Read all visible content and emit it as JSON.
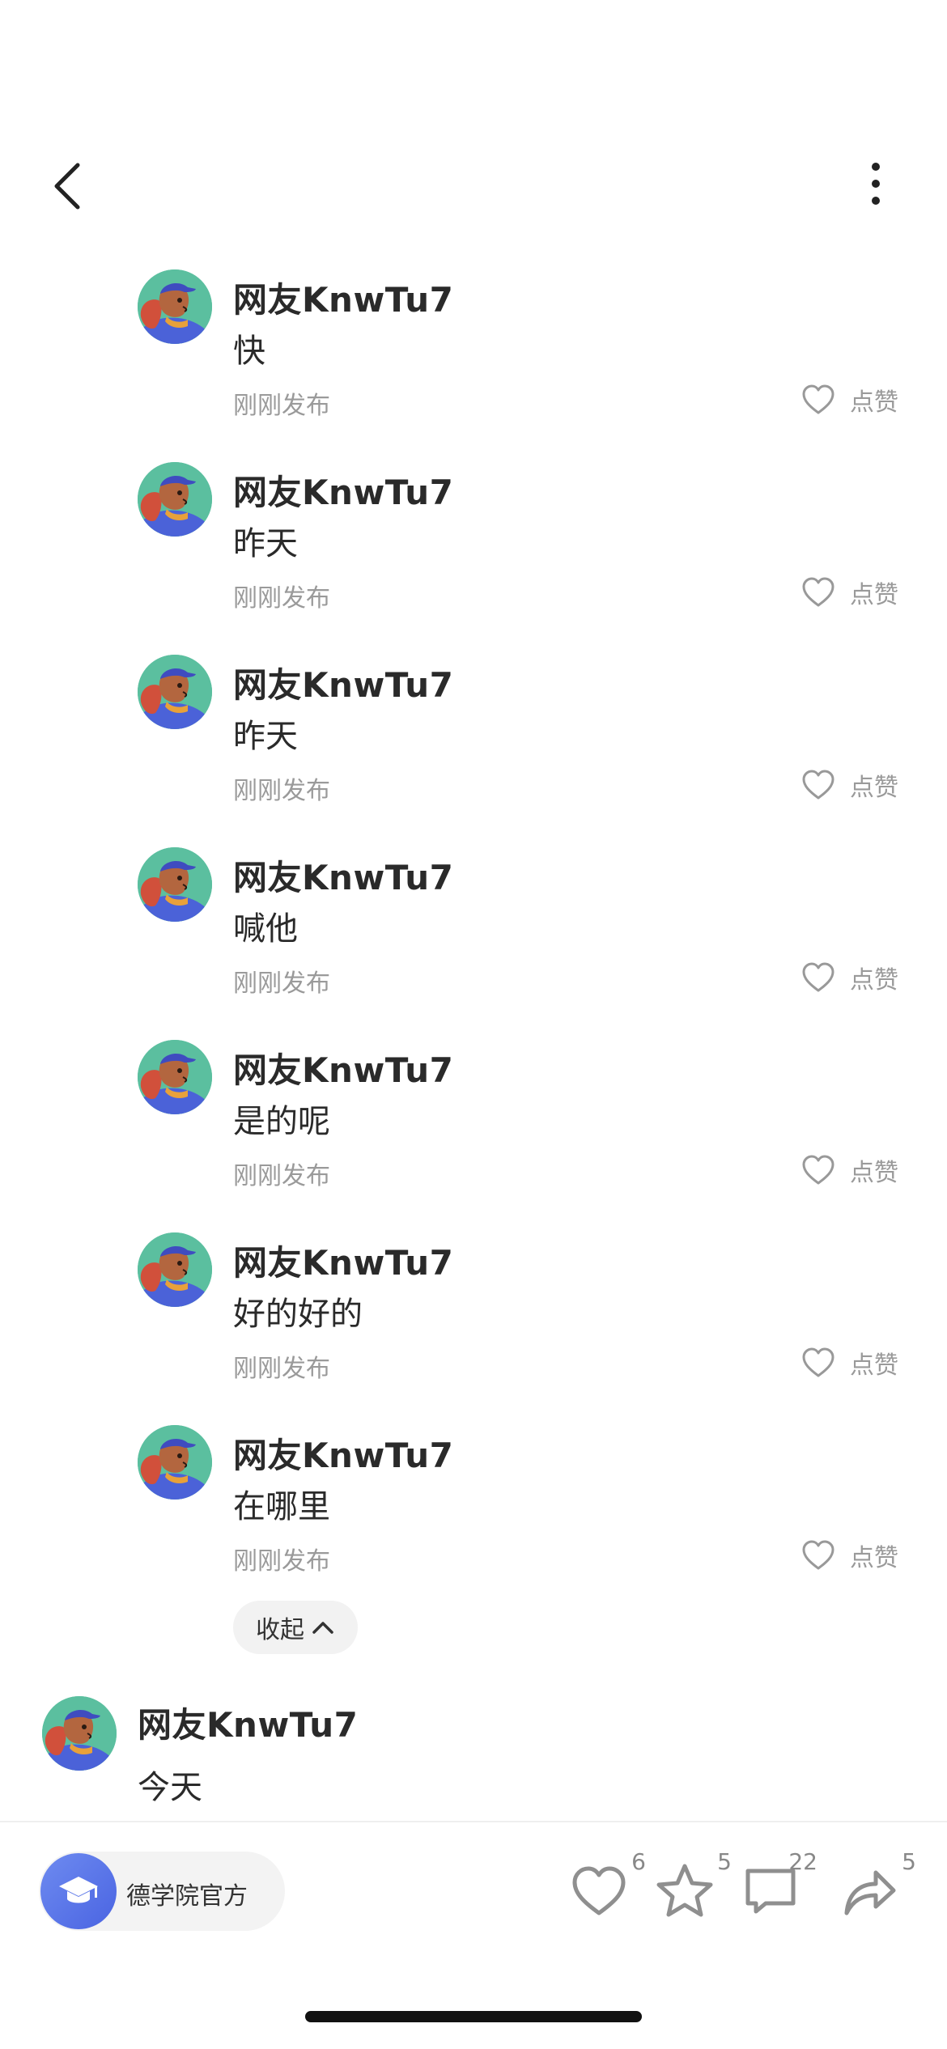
{
  "reply_thread": {
    "replies": [
      {
        "username": "网友KnwTu7",
        "text": "快",
        "time": "刚刚发布",
        "like_label": "点赞"
      },
      {
        "username": "网友KnwTu7",
        "text": "昨天",
        "time": "刚刚发布",
        "like_label": "点赞"
      },
      {
        "username": "网友KnwTu7",
        "text": "昨天",
        "time": "刚刚发布",
        "like_label": "点赞"
      },
      {
        "username": "网友KnwTu7",
        "text": "喊他",
        "time": "刚刚发布",
        "like_label": "点赞"
      },
      {
        "username": "网友KnwTu7",
        "text": "是的呢",
        "time": "刚刚发布",
        "like_label": "点赞"
      },
      {
        "username": "网友KnwTu7",
        "text": "好的好的",
        "time": "刚刚发布",
        "like_label": "点赞"
      },
      {
        "username": "网友KnwTu7",
        "text": "在哪里",
        "time": "刚刚发布",
        "like_label": "点赞"
      }
    ],
    "collapse_label": "收起"
  },
  "top_comment": {
    "username": "网友KnwTu7",
    "text": "今天"
  },
  "bottom_bar": {
    "account_name": "德学院官方",
    "likes_count": "6",
    "favorites_count": "5",
    "comments_count": "22",
    "shares_count": "5"
  },
  "icons": {
    "back": "back-chevron-icon",
    "more": "more-vertical-icon",
    "like": "heart-icon",
    "favorite": "star-icon",
    "comment": "comment-bubble-icon",
    "share": "share-arrow-icon",
    "account": "graduation-cap-icon"
  },
  "colors": {
    "accent_blue": "#5a75ea",
    "avatar_bg": "#5bbf9f",
    "muted_text": "#9a9a9a"
  }
}
